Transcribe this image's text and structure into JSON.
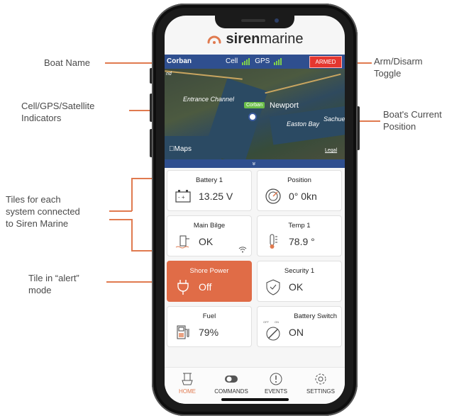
{
  "callouts": {
    "boat_name": "Boat Name",
    "arm_toggle_line1": "Arm/Disarm",
    "arm_toggle_line2": "Toggle",
    "indicators_line1": "Cell/GPS/Satellite",
    "indicators_line2": "Indicators",
    "position_line1": "Boat's Current",
    "position_line2": "Position",
    "tiles_line1": "Tiles for each",
    "tiles_line2": "system connected",
    "tiles_line3": "to Siren Marine",
    "alert_line1": "Tile in “alert”",
    "alert_line2": "mode"
  },
  "app": {
    "brand_bold": "siren",
    "brand_light": "marine",
    "boat_name": "Corban",
    "cell_label": "Cell",
    "gps_label": "GPS",
    "armed_label": "ARMED"
  },
  "map": {
    "label_entrance": "Entrance Channel",
    "label_newport": "Newport",
    "label_easton": "Easton Bay",
    "label_sachue": "Sachue",
    "pin_label": "Corban",
    "attribution": "Maps",
    "legal": "Legal",
    "corner": "nd",
    "expand": "»"
  },
  "tiles": [
    {
      "title": "Battery 1",
      "value": "13.25 V",
      "icon": "battery-icon"
    },
    {
      "title": "Position",
      "value": "0° 0kn",
      "icon": "compass-icon"
    },
    {
      "title": "Main Bilge",
      "value": "OK",
      "icon": "bilge-pump-icon"
    },
    {
      "title": "Temp 1",
      "value": "78.9 °",
      "icon": "thermometer-icon"
    },
    {
      "title": "Shore Power",
      "value": "Off",
      "icon": "plug-icon"
    },
    {
      "title": "Security 1",
      "value": "OK",
      "icon": "shield-icon"
    },
    {
      "title": "Fuel",
      "value": "79%",
      "icon": "fuel-icon"
    },
    {
      "title": "Battery Switch",
      "value": "ON",
      "icon": "switch-icon"
    }
  ],
  "switch_small_off": "OFF",
  "switch_small_on": "ON",
  "tabs": [
    {
      "label": "HOME"
    },
    {
      "label": "COMMANDS"
    },
    {
      "label": "EVENTS"
    },
    {
      "label": "SETTINGS"
    }
  ],
  "colors": {
    "accent": "#e07a4f",
    "statusbar": "#2f4f8f",
    "armed": "#e5362f"
  }
}
